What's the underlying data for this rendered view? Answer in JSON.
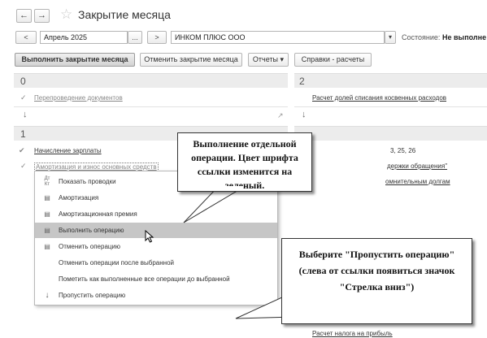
{
  "window": {
    "title": "Закрытие месяца",
    "back_glyph": "←",
    "forward_glyph": "→",
    "star_glyph": "☆"
  },
  "period": {
    "prev_label": "<",
    "value": "Апрель 2025",
    "picker_label": "...",
    "next_label": ">",
    "organization": "ИНКОМ ПЛЮС ООО",
    "org_dropdown": "▾",
    "status_label": "Состояние:",
    "status_value": "Не выполне"
  },
  "toolbar": {
    "execute": "Выполнить закрытие месяца",
    "cancel": "Отменить закрытие месяца",
    "reports": "Отчеты ▾",
    "references": "Справки - расчеты"
  },
  "stage0": {
    "number": "0",
    "items": [
      {
        "label": "Перепроведение документов",
        "mark": "✓"
      }
    ],
    "down": "↓"
  },
  "stage2": {
    "number": "2",
    "items": [
      {
        "label": "Расчет долей списания косвенных расходов"
      }
    ],
    "down": "↓"
  },
  "stage1": {
    "number": "1",
    "items": [
      {
        "label": "Начисление зарплаты",
        "mark": "✔"
      },
      {
        "label": "Амортизация и износ основных средств",
        "mark": "✓"
      }
    ]
  },
  "stage3_partial": [
    "3, 25, 26",
    "держки обращения\"",
    "омнительным долгам"
  ],
  "bottom_link": "Расчет налога на прибыль",
  "menu": {
    "items": [
      {
        "icon": "Дт\nКт",
        "label": "Показать проводки"
      },
      {
        "icon": "▤",
        "label": "Амортизация"
      },
      {
        "icon": "▤",
        "label": "Амортизационная премия"
      },
      {
        "icon": "▤",
        "label": "Выполнить операцию",
        "highlight": true
      },
      {
        "icon": "▤",
        "label": "Отменить операцию"
      },
      {
        "icon": "",
        "label": "Отменить операции после выбранной"
      },
      {
        "icon": "",
        "label": "Пометить как выполненные все операции до выбранной"
      },
      {
        "icon": "↓",
        "label": "Пропустить операцию"
      }
    ]
  },
  "callouts": {
    "top": "Выполнение отдельной операции. Цвет шрифта ссылки изменится на зеленый.",
    "bottom": "Выберите \"Пропустить операцию\" (слева от ссылки появиться значок \"Стрелка вниз\")"
  },
  "resize_glyph": "↗"
}
